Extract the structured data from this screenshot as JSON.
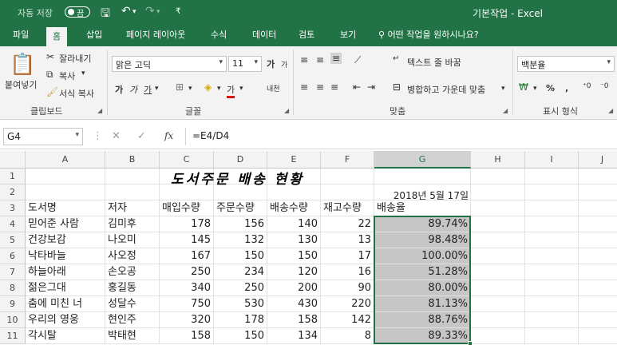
{
  "titlebar": {
    "autosave_label": "자동 저장",
    "autosave_state": "끔",
    "window_title": "기본작업  -  Excel"
  },
  "tabs": [
    "파일",
    "홈",
    "삽입",
    "페이지 레이아웃",
    "수식",
    "데이터",
    "검토",
    "보기"
  ],
  "active_tab": "홈",
  "tell_me": "어떤 작업을 원하시나요?",
  "clipboard": {
    "paste": "붙여넣기",
    "cut": "잘라내기",
    "copy": "복사",
    "format_painter": "서식 복사",
    "group_label": "클립보드"
  },
  "font": {
    "name": "맑은 고딕",
    "size": "11",
    "grow": "가",
    "shrink": "가",
    "bold": "가",
    "italic": "가",
    "underline": "가",
    "font_color": "가",
    "phonetic": "내천",
    "group_label": "글꼴"
  },
  "alignment": {
    "wrap_text": "텍스트 줄 바꿈",
    "merge_center": "병합하고 가운데 맞춤",
    "group_label": "맞춤"
  },
  "number": {
    "format": "백분율",
    "percent": "%",
    "comma": ",",
    "group_label": "표시 형식"
  },
  "formula_bar": {
    "name_box": "G4",
    "fx": "fx",
    "formula": "=E4/D4"
  },
  "grid": {
    "columns": [
      "A",
      "B",
      "C",
      "D",
      "E",
      "F",
      "G",
      "H",
      "I",
      "J"
    ],
    "rows": [
      "1",
      "2",
      "3",
      "4",
      "5",
      "6",
      "7",
      "8",
      "9",
      "10",
      "11"
    ],
    "title": "도서주문 배송 현황",
    "date": "2018년 5월 17일",
    "headers": [
      "도서명",
      "저자",
      "매입수량",
      "주문수량",
      "배송수량",
      "재고수량",
      "배송율"
    ],
    "data": [
      [
        "믿어준 사람",
        "김미후",
        "178",
        "156",
        "140",
        "22",
        "89.74%"
      ],
      [
        "건강보감",
        "나오미",
        "145",
        "132",
        "130",
        "13",
        "98.48%"
      ],
      [
        "낙타바늘",
        "사오정",
        "167",
        "150",
        "150",
        "17",
        "100.00%"
      ],
      [
        "하늘아래",
        "손오공",
        "250",
        "234",
        "120",
        "16",
        "51.28%"
      ],
      [
        "젊은그대",
        "홍길동",
        "340",
        "250",
        "200",
        "90",
        "80.00%"
      ],
      [
        "춤에 미친 너",
        "성달수",
        "750",
        "530",
        "430",
        "220",
        "81.13%"
      ],
      [
        "우리의 영웅",
        "현인주",
        "320",
        "178",
        "158",
        "142",
        "88.76%"
      ],
      [
        "각시탈",
        "박태현",
        "158",
        "150",
        "134",
        "8",
        "89.33%"
      ]
    ]
  },
  "colors": {
    "excel_green": "#217346",
    "selection_fill": "#c6c6c6"
  }
}
